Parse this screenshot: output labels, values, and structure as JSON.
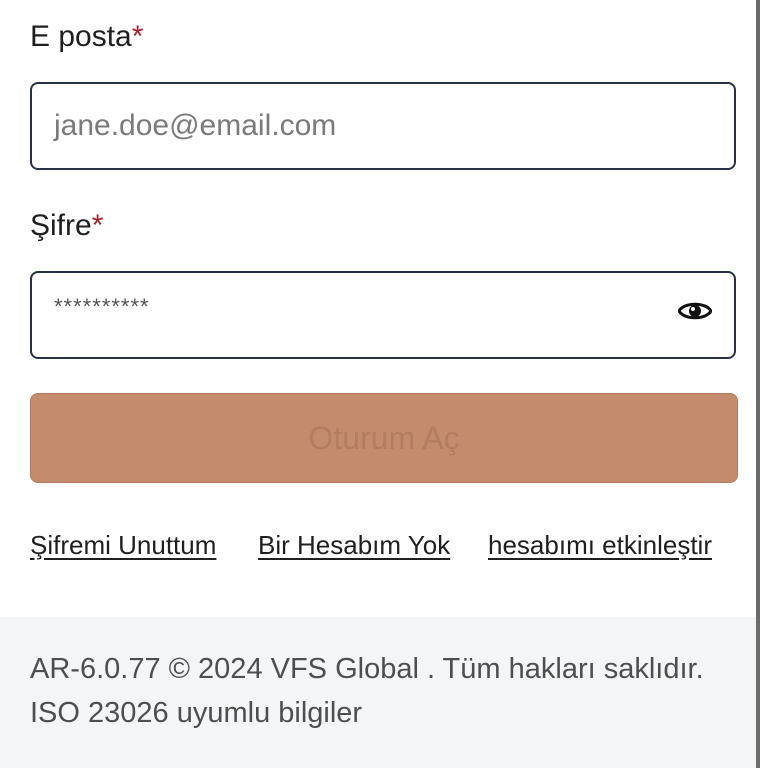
{
  "email": {
    "label": "E posta",
    "required_mark": "*",
    "placeholder": "jane.doe@email.com"
  },
  "password": {
    "label": "Şifre",
    "required_mark": "*",
    "masked_value": "**********",
    "toggle_icon": "eye-icon"
  },
  "login_button": {
    "label": "Oturum Aç",
    "enabled": false
  },
  "links": {
    "forgot_password": "Şifremi Unuttum",
    "no_account": "Bir Hesabım Yok",
    "activate_account": "hesabımı etkinleştir"
  },
  "footer": {
    "text": "AR-6.0.77 © 2024 VFS Global . Tüm hakları saklıdır. ISO 23026 uyumlu bilgiler"
  },
  "colors": {
    "accent_button": "#c58b6d",
    "required": "#a4202a",
    "input_border": "#2a3147",
    "footer_bg": "#f3f5f6"
  }
}
